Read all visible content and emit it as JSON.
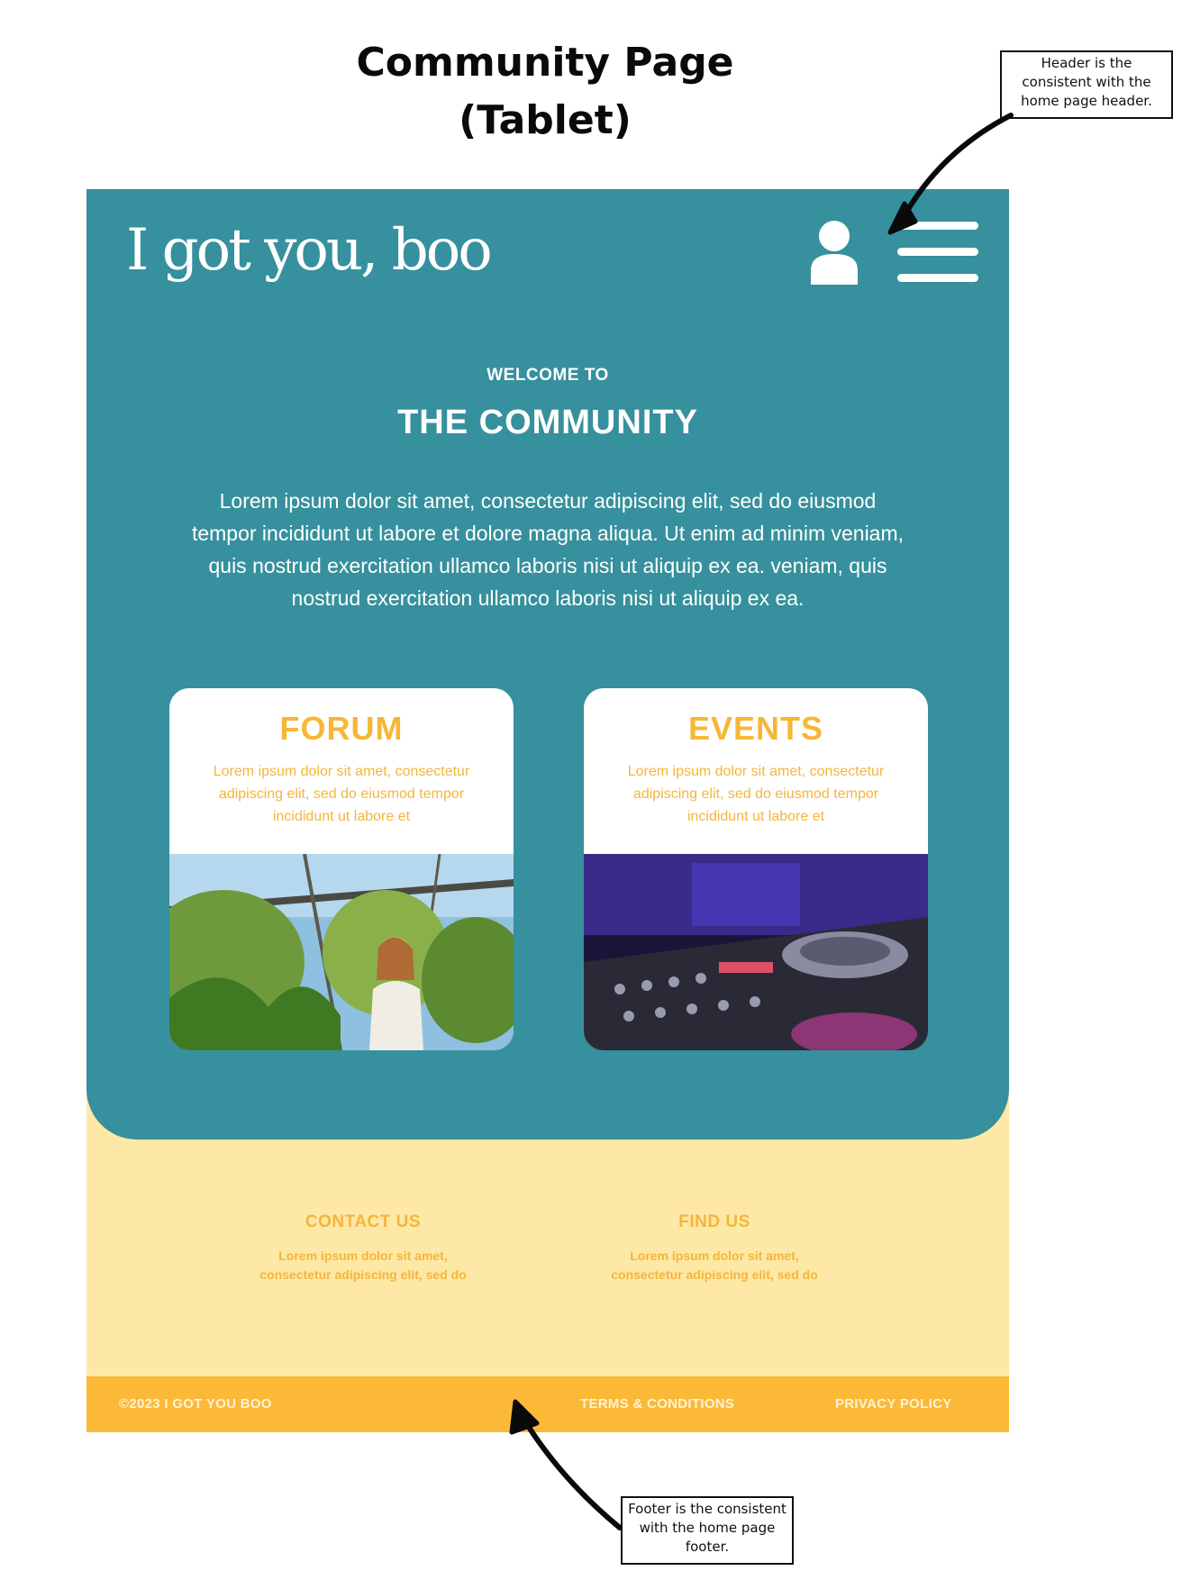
{
  "document": {
    "title_line1": "Community Page",
    "title_line2": "(Tablet)"
  },
  "annotations": {
    "header_note": "Header is the consistent with the home page header.",
    "footer_note": "Footer is the consistent with the home page footer."
  },
  "header": {
    "logo_text": "I got you, boo",
    "icons": [
      "user-icon",
      "hamburger-menu-icon"
    ]
  },
  "hero": {
    "eyebrow": "WELCOME TO",
    "title": "THE COMMUNITY",
    "intro": "Lorem ipsum dolor sit amet, consectetur adipiscing elit, sed do eiusmod tempor incididunt ut labore et dolore magna aliqua. Ut enim ad minim veniam, quis nostrud exercitation ullamco laboris nisi ut aliquip ex ea. veniam, quis nostrud exercitation ullamco laboris nisi ut aliquip ex ea."
  },
  "cards": [
    {
      "title": "FORUM",
      "text": "Lorem ipsum dolor sit amet, consectetur adipiscing elit, sed do eiusmod tempor incididunt ut labore et"
    },
    {
      "title": "EVENTS",
      "text": "Lorem ipsum dolor sit amet, consectetur adipiscing elit, sed do eiusmod tempor incididunt ut labore et"
    }
  ],
  "footer": {
    "contact": {
      "title": "CONTACT US",
      "text": "Lorem ipsum dolor sit amet, consectetur adipiscing elit, sed do"
    },
    "find": {
      "title": "FIND US",
      "text": "Lorem ipsum dolor sit amet, consectetur adipiscing elit, sed do"
    },
    "copyright": "©2023   I GOT YOU BOO",
    "terms": "TERMS & CONDITIONS",
    "privacy": "PRIVACY POLICY"
  },
  "colors": {
    "teal": "#36909d",
    "accent_yellow": "#f7b634",
    "footer_bg": "#fde8a6",
    "bottom_bar": "#fbb937"
  }
}
